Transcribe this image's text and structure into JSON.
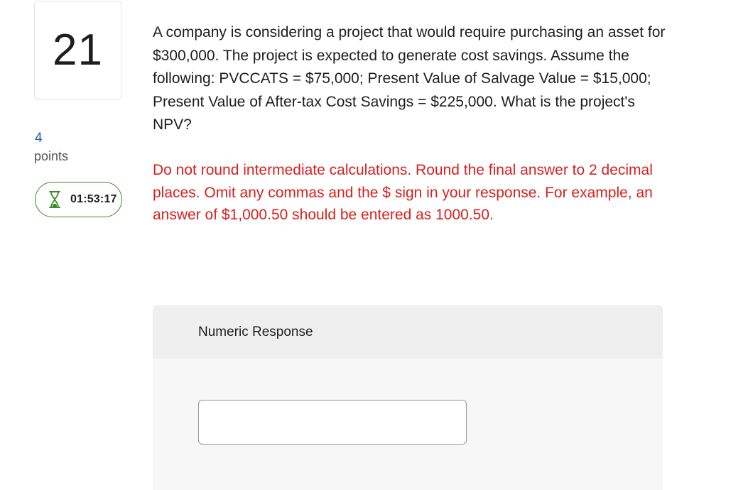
{
  "question": {
    "number": "21",
    "points_value": "4",
    "points_label": "points",
    "timer": "01:53:17",
    "timer_icon": "hourglass-icon",
    "text": "A company is considering a project that would require purchasing an asset for $300,000. The project is expected to generate cost savings. Assume the following: PVCCATS = $75,000; Present Value of Salvage Value = $15,000; Present Value of After-tax Cost Savings = $225,000. What is the project's NPV?",
    "instructions": "Do not round intermediate calculations. Round the final answer to 2 decimal places. Omit any commas and the $ sign in your response. For example, an answer of $1,000.50 should be entered as 1000.50."
  },
  "response": {
    "title": "Numeric Response",
    "value": ""
  },
  "colors": {
    "instructions_red": "#d8201e",
    "points_blue": "#1f5fa8",
    "timer_green": "#3c8a2a"
  }
}
